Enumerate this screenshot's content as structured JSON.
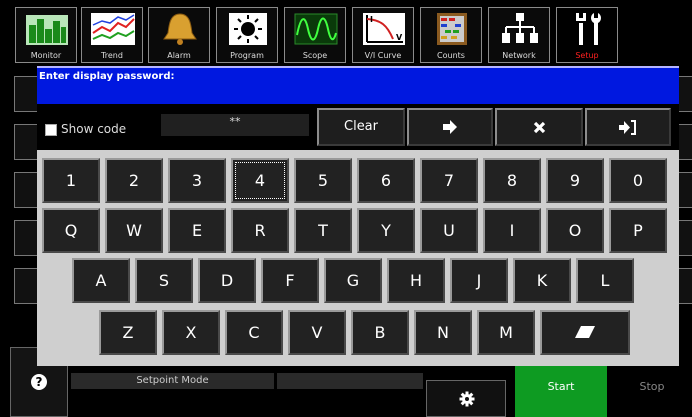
{
  "toolbar": {
    "tabs": [
      {
        "id": "monitor",
        "label": "Monitor",
        "icon": "bar-chart-icon"
      },
      {
        "id": "trend",
        "label": "Trend",
        "icon": "trend-lines-icon"
      },
      {
        "id": "alarm",
        "label": "Alarm",
        "icon": "bell-icon"
      },
      {
        "id": "program",
        "label": "Program",
        "icon": "sun-icon"
      },
      {
        "id": "scope",
        "label": "Scope",
        "icon": "waveform-icon"
      },
      {
        "id": "vi-curve",
        "label": "V/I Curve",
        "icon": "vi-curve-icon"
      },
      {
        "id": "counts",
        "label": "Counts",
        "icon": "abacus-icon"
      },
      {
        "id": "network",
        "label": "Network",
        "icon": "network-icon"
      },
      {
        "id": "setup",
        "label": "Setup",
        "icon": "tools-icon",
        "active": true
      }
    ]
  },
  "dialog": {
    "prompt": "Enter display password:",
    "show_code_label": "Show code",
    "show_code_checked": false,
    "password_value": "**",
    "clear_label": "Clear",
    "buttons": {
      "enter_icon": "arrow-right-icon",
      "cancel_icon": "x-icon",
      "login_icon": "sign-in-icon"
    }
  },
  "keyboard": {
    "row1": [
      "1",
      "2",
      "3",
      "4",
      "5",
      "6",
      "7",
      "8",
      "9",
      "0"
    ],
    "row2": [
      "Q",
      "W",
      "E",
      "R",
      "T",
      "Y",
      "U",
      "I",
      "O",
      "P"
    ],
    "row3": [
      "A",
      "S",
      "D",
      "F",
      "G",
      "H",
      "J",
      "K",
      "L"
    ],
    "row4": [
      "Z",
      "X",
      "C",
      "V",
      "B",
      "N",
      "M"
    ],
    "eraser_icon": "eraser-icon"
  },
  "background": {
    "setpoint_mode_label": "Setpoint Mode",
    "start_label": "Start",
    "stop_label": "Stop"
  },
  "colors": {
    "dialog_header": "#0018e0",
    "start_button": "#0e9b22",
    "setup_label_active": "#ff2020",
    "keyboard_panel": "#cfcfcf"
  }
}
